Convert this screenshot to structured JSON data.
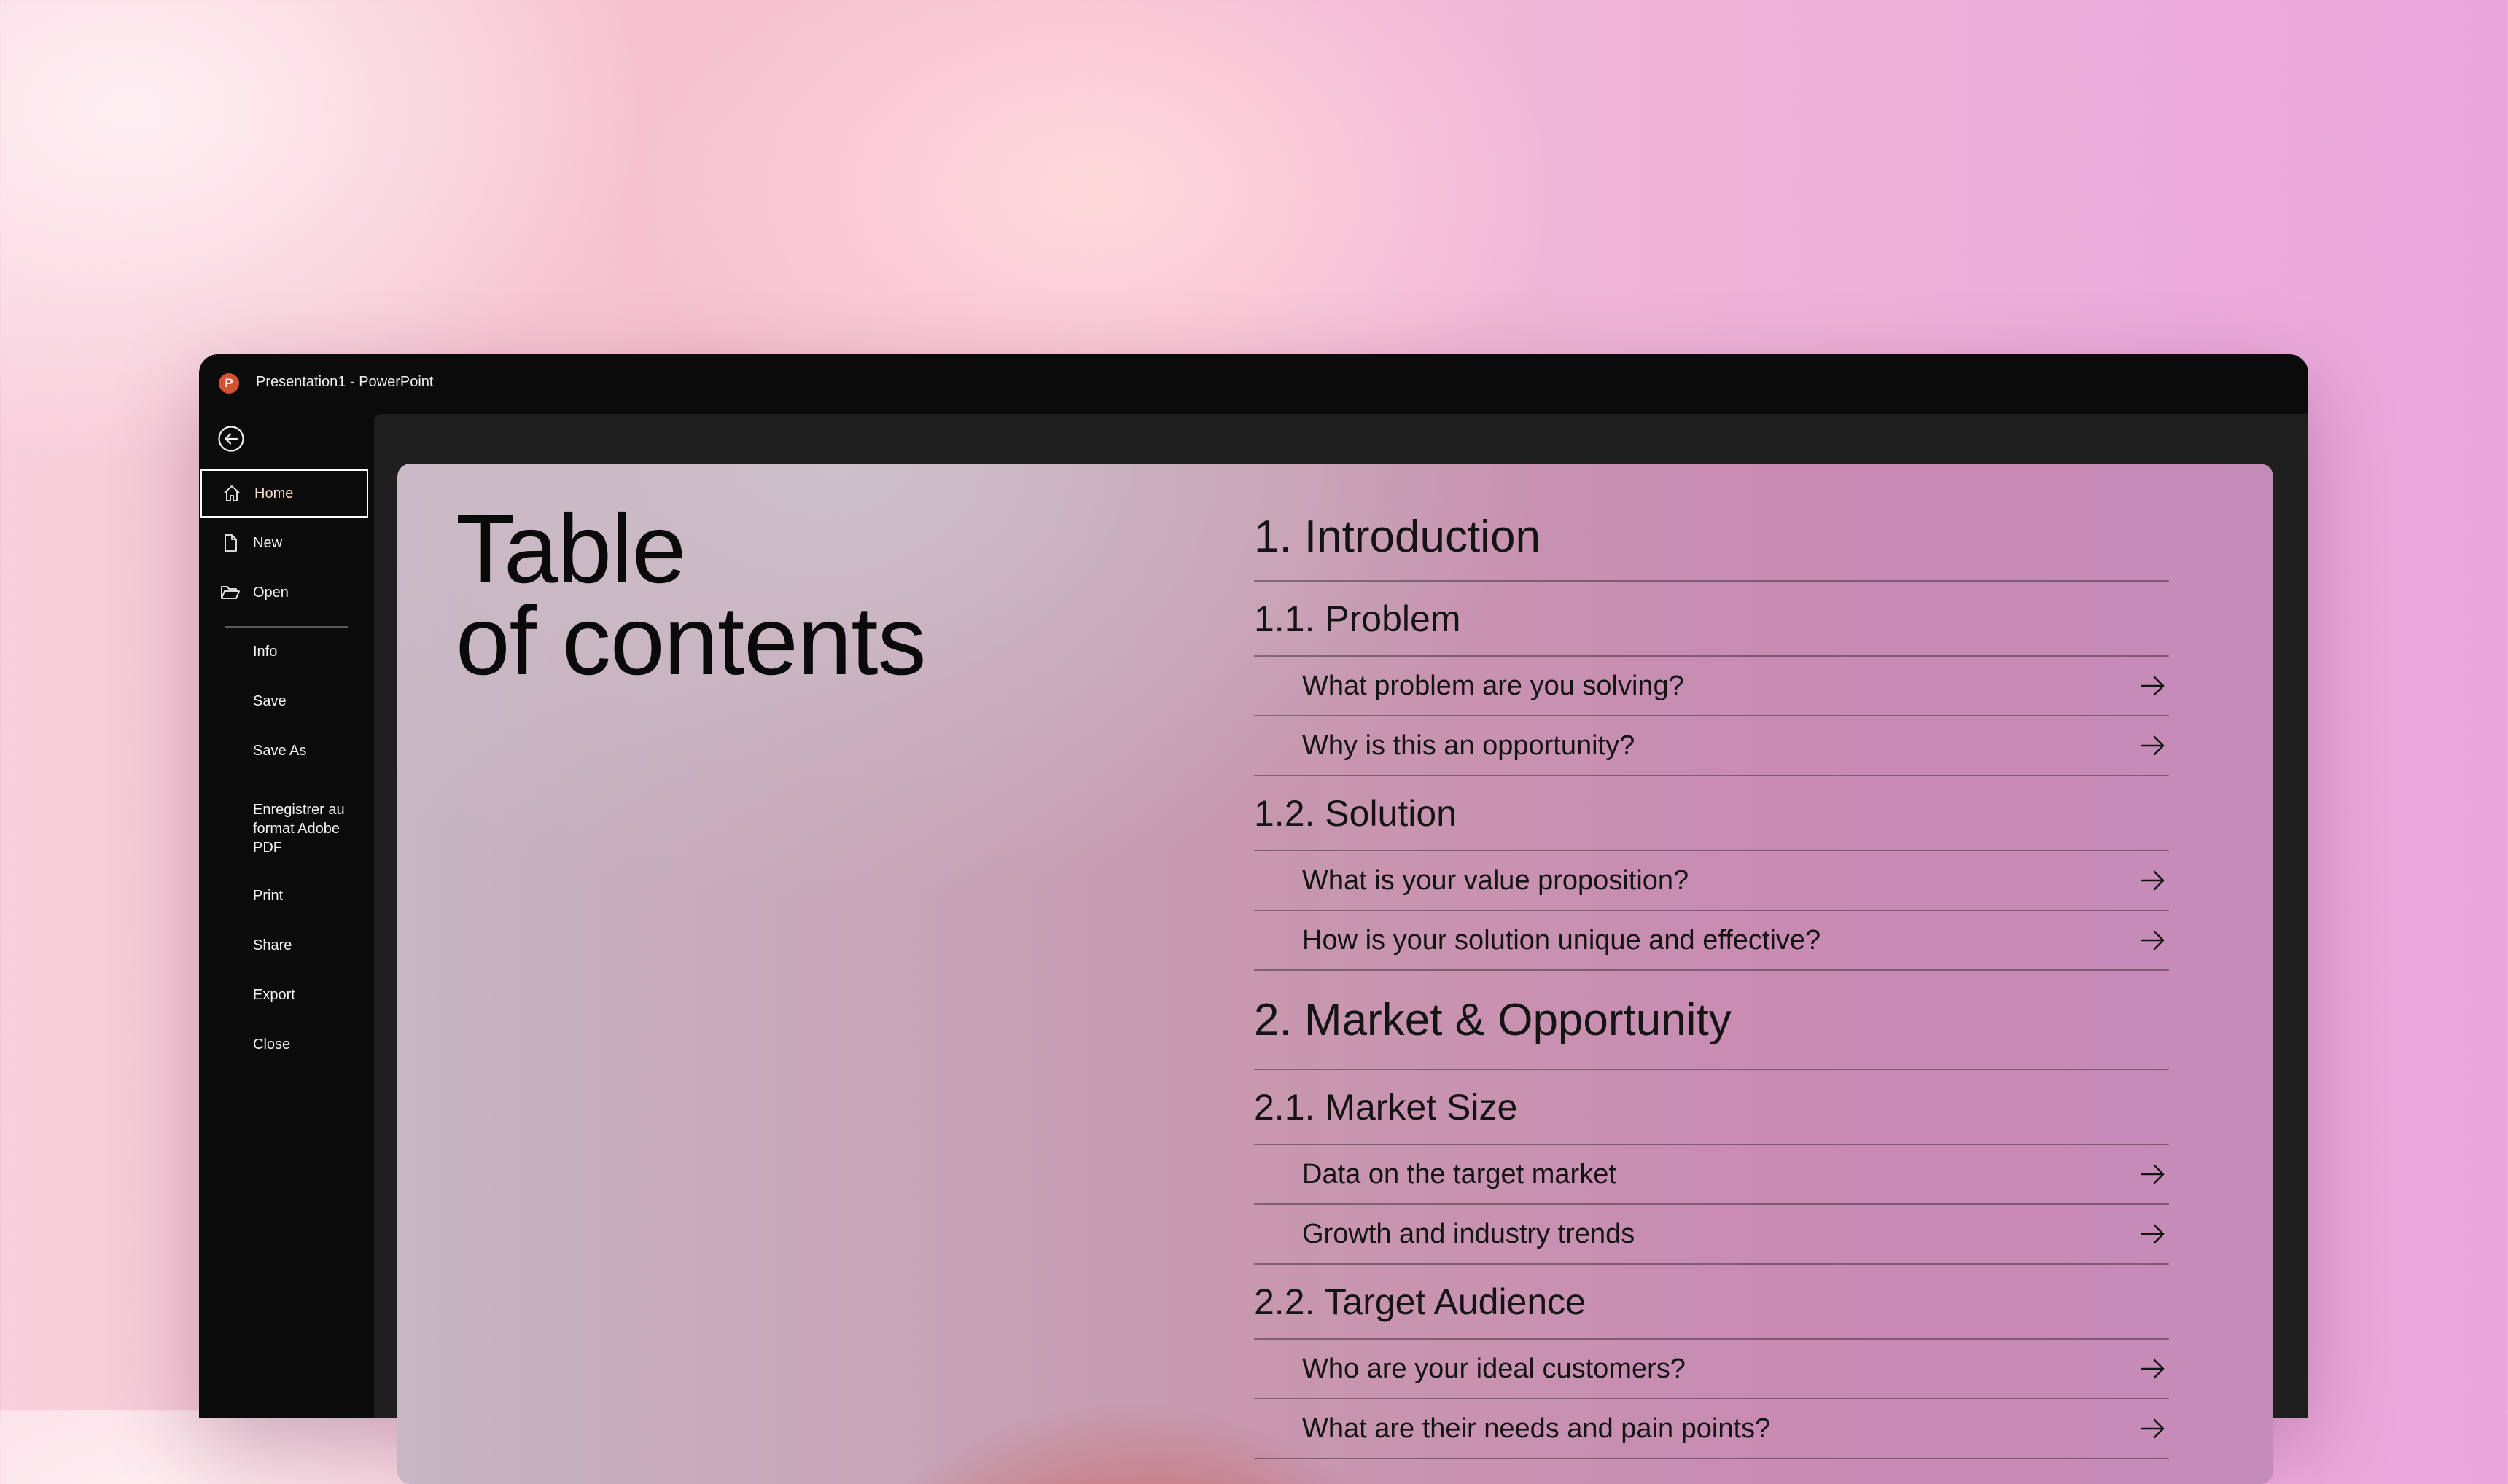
{
  "window": {
    "app_logo_letter": "P",
    "title": "Presentation1  -  PowerPoint"
  },
  "sidebar": {
    "back_icon": "back-arrow-circle-icon",
    "items": [
      {
        "label": "Home",
        "icon": "home-icon",
        "active": true
      },
      {
        "label": "New",
        "icon": "new-file-icon"
      },
      {
        "label": "Open",
        "icon": "folder-open-icon"
      },
      {
        "label": "Info"
      },
      {
        "label": "Save"
      },
      {
        "label": "Save As"
      },
      {
        "label": "Enregistrer au format Adobe PDF"
      },
      {
        "label": "Print"
      },
      {
        "label": "Share"
      },
      {
        "label": "Export"
      },
      {
        "label": "Close"
      }
    ]
  },
  "slide": {
    "title_line1": "Table",
    "title_line2": "of contents",
    "toc": [
      {
        "level": "h1",
        "text": "1. Introduction"
      },
      {
        "level": "h2",
        "text": "1.1. Problem"
      },
      {
        "level": "item",
        "text": "What problem are you solving?"
      },
      {
        "level": "item",
        "text": "Why is this an opportunity?"
      },
      {
        "level": "h2",
        "text": "1.2. Solution"
      },
      {
        "level": "item",
        "text": "What is your value proposition?"
      },
      {
        "level": "item",
        "text": "How is your solution unique and effective?"
      },
      {
        "level": "h1",
        "text": "2. Market & Opportunity"
      },
      {
        "level": "h2",
        "text": "2.1. Market Size"
      },
      {
        "level": "item",
        "text": "Data on the target market"
      },
      {
        "level": "item",
        "text": "Growth and industry trends"
      },
      {
        "level": "h2",
        "text": "2.2. Target Audience"
      },
      {
        "level": "item",
        "text": "Who are your ideal customers?"
      },
      {
        "level": "item",
        "text": "What are their needs and pain points?"
      }
    ]
  },
  "colors": {
    "accent_powerpoint": "#d35230",
    "window_bg": "#0b0b0b",
    "content_bg": "#1f1f1f"
  }
}
